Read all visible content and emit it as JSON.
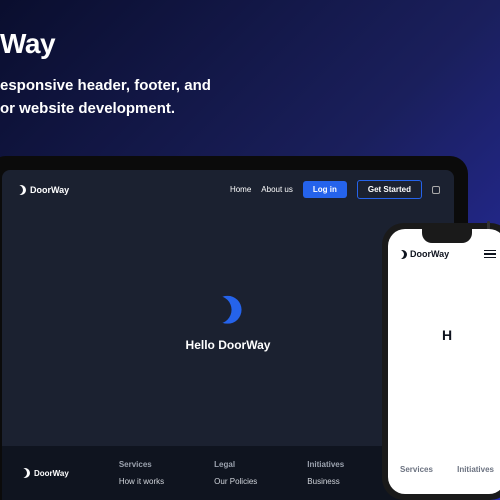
{
  "hero": {
    "title_suffix": "Way",
    "subtitle_l1": "esponsive header, footer, and",
    "subtitle_l2": "or website development."
  },
  "brand_name": "DoorWay",
  "laptop": {
    "nav": {
      "home": "Home",
      "about": "About us",
      "login": "Log in",
      "get_started": "Get Started"
    },
    "center_text": "Hello DoorWay",
    "footer": {
      "col1": {
        "title": "Services",
        "link": "How it works"
      },
      "col2": {
        "title": "Legal",
        "link": "Our Policies"
      },
      "col3": {
        "title": "Initiatives",
        "link": "Business"
      }
    }
  },
  "phone": {
    "body_text_partial": "H",
    "footer": {
      "col1_title": "Services",
      "col2_title": "Initiatives"
    }
  }
}
